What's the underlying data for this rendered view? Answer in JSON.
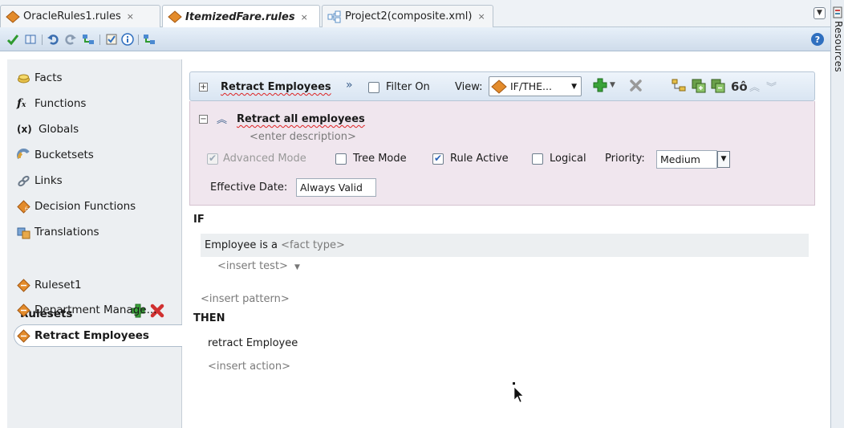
{
  "tabs": [
    {
      "label": "OracleRules1.rules",
      "close": "×"
    },
    {
      "label": "ItemizedFare.rules",
      "close": "×"
    },
    {
      "label": "Project2(composite.xml)",
      "close": "×"
    }
  ],
  "side_panel": {
    "label": "Resources"
  },
  "nav": {
    "items": [
      {
        "label": "Facts",
        "icon": "facts-icon"
      },
      {
        "label": "Functions",
        "icon": "functions-icon"
      },
      {
        "label": "Globals",
        "icon": "globals-icon"
      },
      {
        "label": "Bucketsets",
        "icon": "bucketsets-icon"
      },
      {
        "label": "Links",
        "icon": "links-icon"
      },
      {
        "label": "Decision Functions",
        "icon": "decision-functions-icon"
      },
      {
        "label": "Translations",
        "icon": "translations-icon"
      }
    ],
    "rulesets_heading": "Rulesets",
    "rulesets": [
      {
        "label": "Ruleset1"
      },
      {
        "label": "Department Manage..."
      },
      {
        "label": "Retract Employees"
      }
    ]
  },
  "ruleset_header": {
    "title": "Retract Employees",
    "filter_label": "Filter On",
    "view_label": "View:",
    "view_value": "IF/THE..."
  },
  "rule": {
    "name": "Retract all employees",
    "description_placeholder": "<enter description>",
    "advanced_mode_label": "Advanced Mode",
    "tree_mode_label": "Tree Mode",
    "rule_active_label": "Rule Active",
    "logical_label": "Logical",
    "priority_label": "Priority:",
    "priority_value": "Medium",
    "effective_date_label": "Effective Date:",
    "effective_date_value": "Always Valid"
  },
  "conditions": {
    "if_label": "IF",
    "pattern_prefix": "Employee is a",
    "fact_type_placeholder": "<fact type>",
    "insert_test": "<insert test>",
    "insert_pattern": "<insert pattern>"
  },
  "actions": {
    "then_label": "THEN",
    "action_text": "retract Employee",
    "insert_action": "<insert action>"
  },
  "colors": {
    "rule_body_bg": "#f0e6ee",
    "add_green": "#3aa33a",
    "delete_red": "#d03030",
    "toolbar_blue": "#cfdceb"
  }
}
